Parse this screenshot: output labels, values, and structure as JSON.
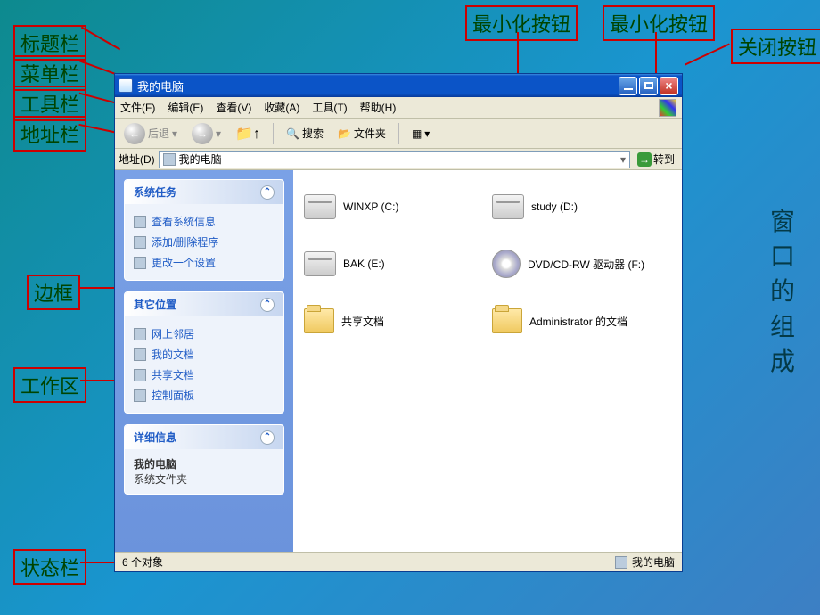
{
  "slide": {
    "side_title": "窗口的组成",
    "annotations": {
      "titlebar": "标题栏",
      "menubar": "菜单栏",
      "toolbar": "工具栏",
      "addressbar": "地址栏",
      "border": "边框",
      "workarea": "工作区",
      "statusbar": "状态栏",
      "minimize": "最小化按钮",
      "maximize": "最小化按钮",
      "close": "关闭按钮"
    }
  },
  "window": {
    "title": "我的电脑",
    "menus": [
      "文件(F)",
      "编辑(E)",
      "查看(V)",
      "收藏(A)",
      "工具(T)",
      "帮助(H)"
    ],
    "toolbar": {
      "back": "后退",
      "search": "搜索",
      "folders": "文件夹"
    },
    "addressbar": {
      "label": "地址(D)",
      "value": "我的电脑",
      "go": "转到"
    },
    "sidebar": {
      "system_tasks": {
        "title": "系统任务",
        "items": [
          "查看系统信息",
          "添加/删除程序",
          "更改一个设置"
        ]
      },
      "other_places": {
        "title": "其它位置",
        "items": [
          "网上邻居",
          "我的文档",
          "共享文档",
          "控制面板"
        ]
      },
      "details": {
        "title": "详细信息",
        "name": "我的电脑",
        "type": "系统文件夹"
      }
    },
    "items": [
      {
        "type": "drive",
        "label": "WINXP (C:)"
      },
      {
        "type": "drive",
        "label": "study (D:)"
      },
      {
        "type": "drive",
        "label": "BAK (E:)"
      },
      {
        "type": "cd",
        "label": "DVD/CD-RW 驱动器 (F:)"
      },
      {
        "type": "folder",
        "label": "共享文档"
      },
      {
        "type": "folder",
        "label": "Administrator 的文档"
      }
    ],
    "statusbar": {
      "left": "6 个对象",
      "right": "我的电脑"
    }
  }
}
